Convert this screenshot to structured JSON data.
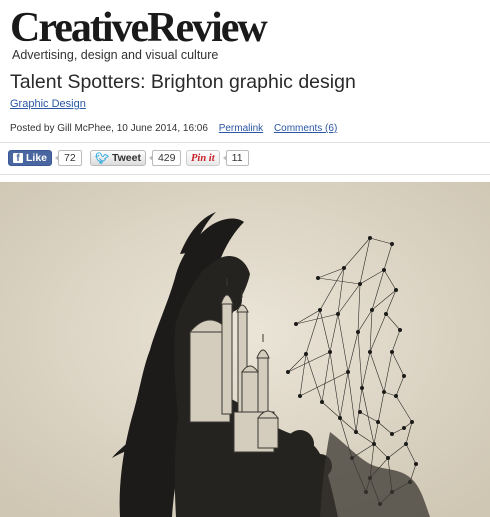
{
  "site": {
    "logo": "CreativeReview",
    "tagline": "Advertising, design and visual culture"
  },
  "article": {
    "title": "Talent Spotters: Brighton graphic design",
    "category": "Graphic Design",
    "posted_by": "Posted by Gill McPhee, 10 June 2014, 16:06",
    "permalink_label": "Permalink",
    "comments_label": "Comments (6)"
  },
  "share": {
    "facebook_label": "Like",
    "facebook_count": "72",
    "twitter_label": "Tweet",
    "twitter_count": "429",
    "pinterest_label": "Pin it",
    "pinterest_count": "11"
  },
  "colors": {
    "link": "#2b57a4",
    "facebook": "#4a66a0",
    "pinterest": "#c8232c",
    "twitter": "#2aa9e0"
  },
  "icons": {
    "facebook": "facebook-icon",
    "twitter": "twitter-bird-icon"
  }
}
